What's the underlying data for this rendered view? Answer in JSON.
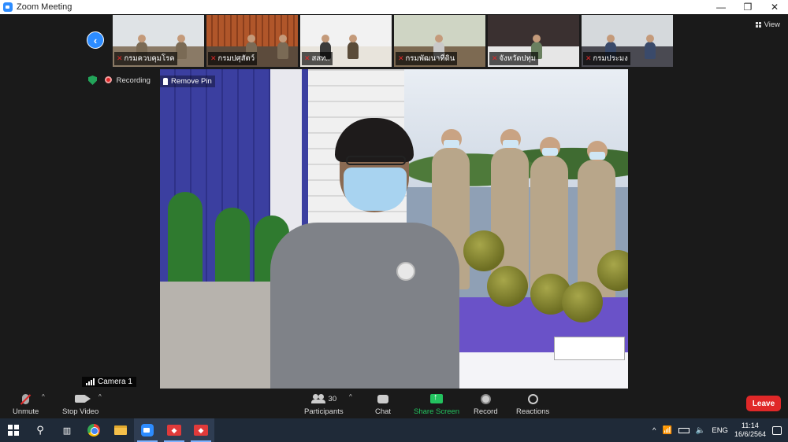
{
  "window": {
    "title": "Zoom Meeting",
    "minimize_glyph": "—",
    "restore_glyph": "❐",
    "close_glyph": "✕"
  },
  "gallery": {
    "prev_glyph": "‹",
    "tiles": [
      {
        "name": "กรมควบคุมโรค",
        "mic": "muted"
      },
      {
        "name": "กรมปศุสัตว์",
        "mic": "muted"
      },
      {
        "name": "สสท..",
        "mic": "muted"
      },
      {
        "name": "กรมพัฒนาที่ดิน",
        "mic": "muted"
      },
      {
        "name": "จังหวัดปทุม",
        "mic": "muted"
      },
      {
        "name": "กรมประมง",
        "mic": "muted"
      }
    ]
  },
  "view_button": {
    "label": "View"
  },
  "status": {
    "recording_label": "Recording"
  },
  "main_video": {
    "remove_pin_label": "Remove Pin",
    "camera_label": "Camera 1"
  },
  "toolbar": {
    "unmute_label": "Unmute",
    "stop_video_label": "Stop Video",
    "participants_label": "Participants",
    "participants_count": "30",
    "chat_label": "Chat",
    "share_screen_label": "Share Screen",
    "record_label": "Record",
    "reactions_label": "Reactions",
    "leave_label": "Leave",
    "caret_glyph": "^"
  },
  "taskbar": {
    "language": "ENG",
    "time": "11:14",
    "date": "16/6/2564",
    "tray_chevron": "^"
  },
  "colors": {
    "zoom_blue": "#2d8cff",
    "leave_red": "#e02828",
    "share_green": "#23c35f"
  }
}
